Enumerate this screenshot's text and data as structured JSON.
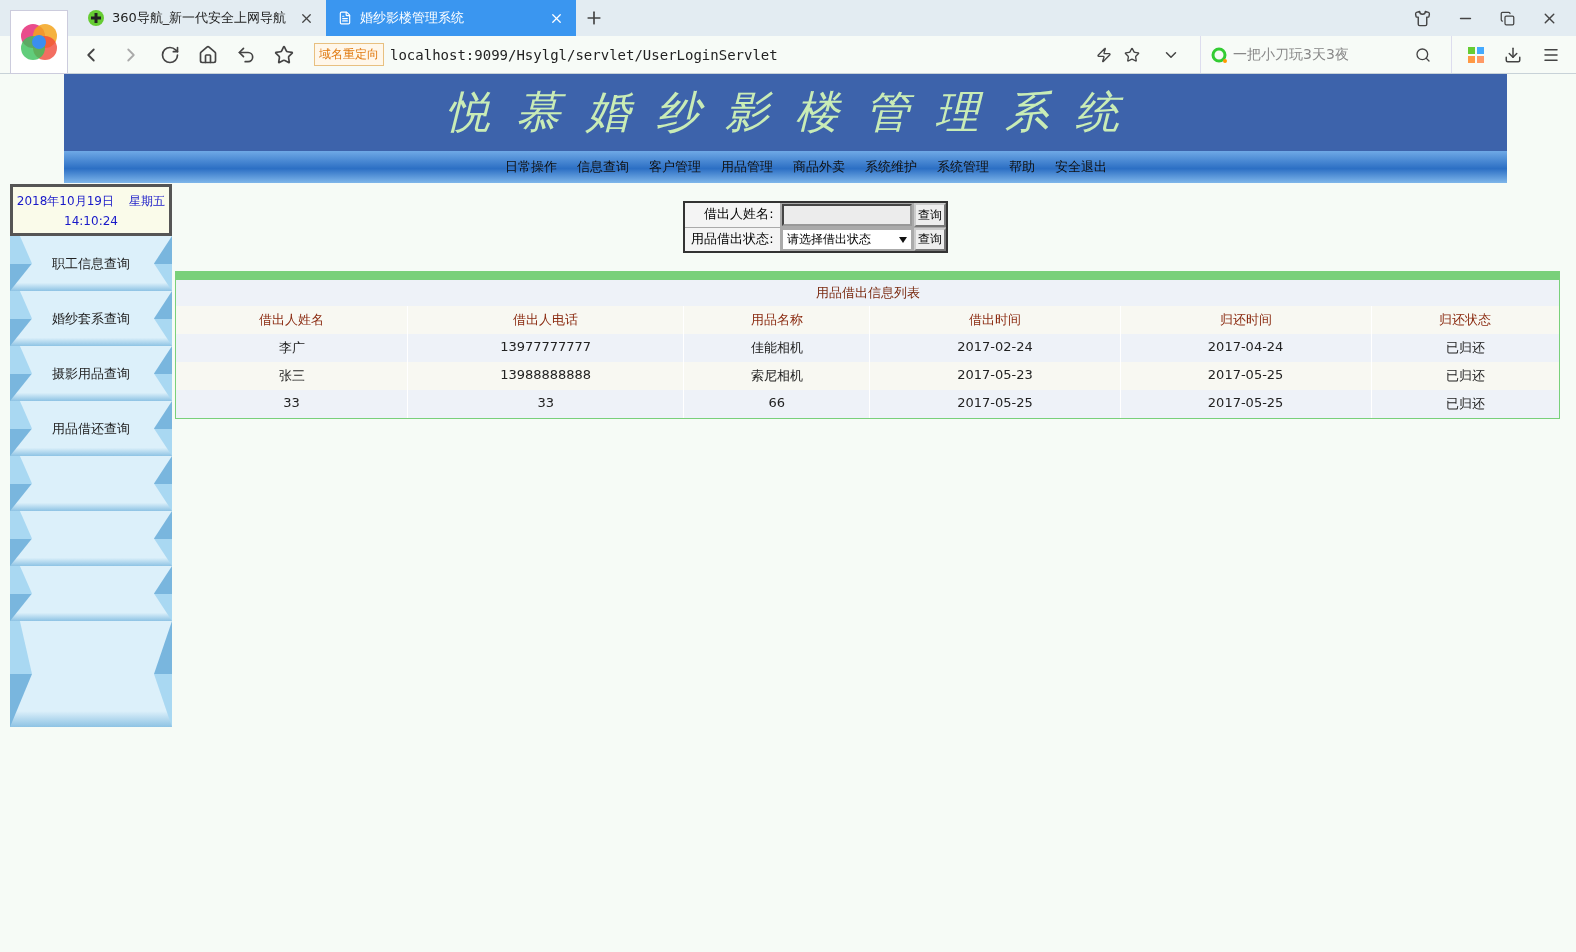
{
  "browser": {
    "tabs": [
      {
        "title": "360导航_新一代安全上网导航",
        "selected": false
      },
      {
        "title": "婚纱影楼管理系统",
        "selected": true
      }
    ],
    "address_badge": "域名重定向",
    "url": "localhost:9099/Hsylgl/servlet/UserLoginServlet",
    "search_placeholder": "一把小刀玩3天3夜"
  },
  "banner": {
    "title": "悦 慕 婚 纱 影 楼 管 理 系 统"
  },
  "nav": [
    "日常操作",
    "信息查询",
    "客户管理",
    "用品管理",
    "商品外卖",
    "系统维护",
    "系统管理",
    "帮助",
    "安全退出"
  ],
  "clock": {
    "date": "2018年10月19日",
    "weekday": "星期五",
    "time": "14:10:24"
  },
  "sidebar": {
    "items": [
      "职工信息查询",
      "婚纱套系查询",
      "摄影用品查询",
      "用品借还查询"
    ]
  },
  "search_form": {
    "rows": [
      {
        "kind": "text",
        "label": "借出人姓名:",
        "button": "查询"
      },
      {
        "kind": "select",
        "label": "用品借出状态:",
        "value": "请选择借出状态",
        "button": "查询"
      }
    ]
  },
  "table": {
    "title": "用品借出信息列表",
    "columns": [
      "借出人姓名",
      "借出人电话",
      "用品名称",
      "借出时间",
      "归还时间",
      "归还状态"
    ],
    "rows": [
      [
        "李广",
        "13977777777",
        "佳能相机",
        "2017-02-24",
        "2017-04-24",
        "已归还"
      ],
      [
        "张三",
        "13988888888",
        "索尼相机",
        "2017-05-23",
        "2017-05-25",
        "已归还"
      ],
      [
        "33",
        "33",
        "66",
        "2017-05-25",
        "2017-05-25",
        "已归还"
      ]
    ]
  }
}
